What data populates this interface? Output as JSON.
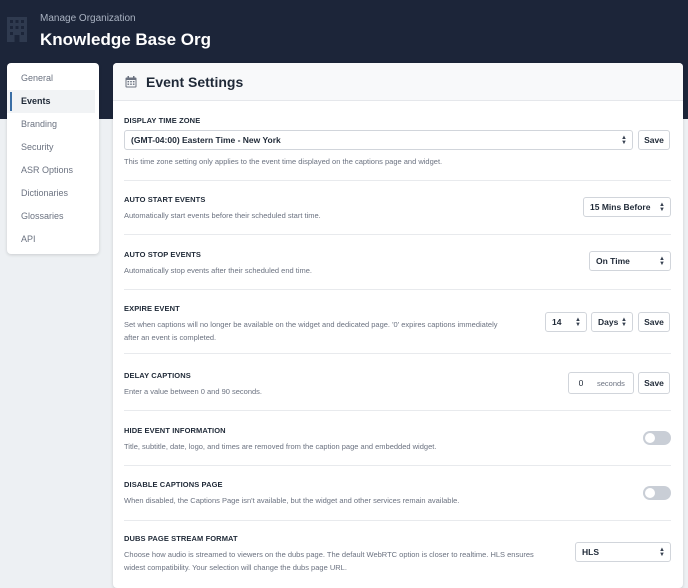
{
  "header": {
    "subtitle": "Manage Organization",
    "title": "Knowledge Base Org"
  },
  "sidebar": {
    "items": [
      {
        "label": "General"
      },
      {
        "label": "Events",
        "active": true
      },
      {
        "label": "Branding"
      },
      {
        "label": "Security"
      },
      {
        "label": "ASR Options"
      },
      {
        "label": "Dictionaries"
      },
      {
        "label": "Glossaries"
      },
      {
        "label": "API"
      }
    ]
  },
  "panel": {
    "title": "Event Settings",
    "icon": "calendar-icon"
  },
  "settings": {
    "timezone": {
      "label": "DISPLAY TIME ZONE",
      "value": "(GMT-04:00) Eastern Time - New York",
      "save_label": "Save",
      "description": "This time zone setting only applies to the event time displayed on the captions page and widget."
    },
    "auto_start": {
      "label": "AUTO START EVENTS",
      "description": "Automatically start events before their scheduled start time.",
      "value": "15 Mins Before"
    },
    "auto_stop": {
      "label": "AUTO STOP EVENTS",
      "description": "Automatically stop events after their scheduled end time.",
      "value": "On Time"
    },
    "expire": {
      "label": "EXPIRE EVENT",
      "description_line1": "Set when captions will no longer be available on the widget and dedicated page. '0' expires captions immediately",
      "description_line2": "after an event is completed.",
      "number_value": "14",
      "unit_value": "Days",
      "save_label": "Save"
    },
    "delay": {
      "label": "DELAY CAPTIONS",
      "description": "Enter a value between 0 and 90 seconds.",
      "value": "0",
      "unit": "seconds",
      "save_label": "Save"
    },
    "hide_info": {
      "label": "HIDE EVENT INFORMATION",
      "description": "Title, subtitle, date, logo, and times are removed from the caption page and embedded widget.",
      "enabled": false
    },
    "disable_captions": {
      "label": "DISABLE CAPTIONS PAGE",
      "description": "When disabled, the Captions Page isn't available, but the widget and other services remain available.",
      "enabled": false
    },
    "dubs_format": {
      "label": "DUBS PAGE STREAM FORMAT",
      "description_line1": "Choose how audio is streamed to viewers on the dubs page. The default WebRTC option is closer to realtime. HLS ensures",
      "description_line2": "widest compatibility. Your selection will change the dubs page URL.",
      "value": "HLS"
    }
  }
}
